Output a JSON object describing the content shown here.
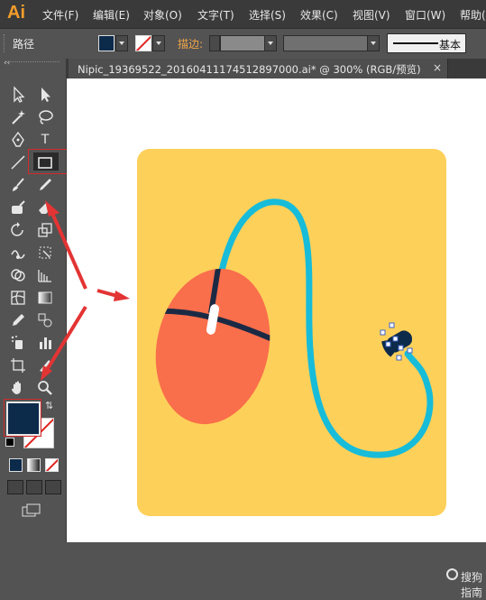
{
  "app": {
    "logo": "Ai"
  },
  "menu": [
    "文件(F)",
    "编辑(E)",
    "对象(O)",
    "文字(T)",
    "选择(S)",
    "效果(C)",
    "视图(V)",
    "窗口(W)",
    "帮助("
  ],
  "control_bar": {
    "object_type": "路径",
    "stroke_label": "描边:",
    "brush_label": "基本",
    "fill_color": "#0c2a4a",
    "stroke_color": "none"
  },
  "document": {
    "tab_title": "Nipic_19369522_20160411174512897000.ai*  @  300%  (RGB/预览)",
    "close_glyph": "×"
  },
  "tools": [
    "selection-tool",
    "direct-selection-tool",
    "magic-wand-tool",
    "lasso-tool",
    "pen-tool",
    "type-tool",
    "line-segment-tool",
    "rectangle-tool",
    "paintbrush-tool",
    "pencil-tool",
    "blob-brush-tool",
    "eraser-tool",
    "rotate-tool",
    "scale-tool",
    "warp-tool",
    "free-transform-tool",
    "shape-builder-tool",
    "perspective-grid-tool",
    "mesh-tool",
    "gradient-tool",
    "eyedropper-tool",
    "blend-tool",
    "symbol-sprayer-tool",
    "column-graph-tool",
    "artboard-tool",
    "slice-tool",
    "hand-tool",
    "zoom-tool"
  ],
  "tool_type_glyph": "T",
  "swap_glyph": "⇅",
  "colors": {
    "card": "#fdd05a",
    "mouse_body": "#f96e4b",
    "mouse_line": "#1b2a44",
    "cable": "#17bcd9",
    "plug": "#0c2a4a",
    "annotation": "#e33434"
  },
  "watermark": "搜狗指南"
}
